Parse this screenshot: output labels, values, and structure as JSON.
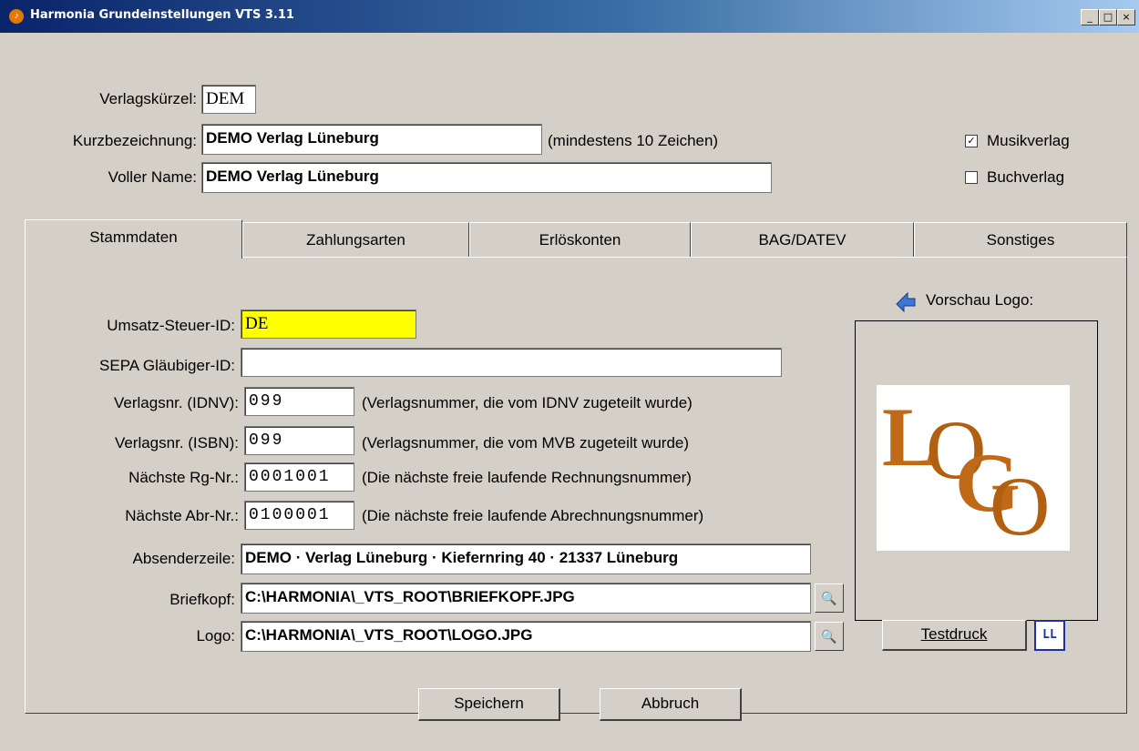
{
  "window": {
    "title": "Harmonia Grundeinstellungen VTS 3.11",
    "minimize": "_",
    "maximize": "□",
    "close": "×"
  },
  "header": {
    "verlagskuerzel": {
      "label": "Verlagskürzel:",
      "value": "DEM"
    },
    "kurzbezeichnung": {
      "label": "Kurzbezeichnung:",
      "value": "DEMO Verlag Lüneburg",
      "hint": "(mindestens 10 Zeichen)"
    },
    "voller_name": {
      "label": "Voller Name:",
      "value": "DEMO Verlag Lüneburg"
    },
    "musikverlag": {
      "label": "Musikverlag",
      "checked": "☑",
      "mark": "✓"
    },
    "buchverlag": {
      "label": "Buchverlag",
      "mark": ""
    }
  },
  "tabs": [
    "Stammdaten",
    "Zahlungsarten",
    "Erlöskonten",
    "BAG/DATEV",
    "Sonstiges"
  ],
  "stammdaten": {
    "ust_id": {
      "label": "Umsatz-Steuer-ID:",
      "value": "DE"
    },
    "sepa": {
      "label": "SEPA Gläubiger-ID:",
      "value": ""
    },
    "idnv": {
      "label": "Verlagsnr. (IDNV):",
      "value": "099",
      "hint": "(Verlagsnummer, die vom IDNV zugeteilt wurde)"
    },
    "isbn": {
      "label": "Verlagsnr. (ISBN):",
      "value": "099",
      "hint": "(Verlagsnummer, die vom MVB zugeteilt wurde)"
    },
    "rg_nr": {
      "label": "Nächste Rg-Nr.:",
      "value": "0001001",
      "hint": "(Die nächste freie laufende Rechnungsnummer)"
    },
    "abr_nr": {
      "label": "Nächste Abr-Nr.:",
      "value": "0100001",
      "hint": "(Die nächste freie laufende Abrechnungsnummer)"
    },
    "absender": {
      "label": "Absenderzeile:",
      "value": "DEMO · Verlag Lüneburg · Kiefernring 40 · 21337 Lüneburg"
    },
    "briefkopf": {
      "label": "Briefkopf:",
      "value": "C:\\HARMONIA\\_VTS_ROOT\\BRIEFKOPF.JPG"
    },
    "logo": {
      "label": "Logo:",
      "value": "C:\\HARMONIA\\_VTS_ROOT\\LOGO.JPG"
    },
    "vorschau_label": "Vorschau Logo:",
    "logo_text_1": "L",
    "logo_text_2": "O",
    "logo_text_3": "G",
    "logo_text_4": "O",
    "testdruck": "Testdruck",
    "ll_label": "LL",
    "browse_icon": "binoculars-icon",
    "ust_color": "#ffff00"
  },
  "footer": {
    "speichern": "Speichern",
    "abbruch": "Abbruch"
  }
}
